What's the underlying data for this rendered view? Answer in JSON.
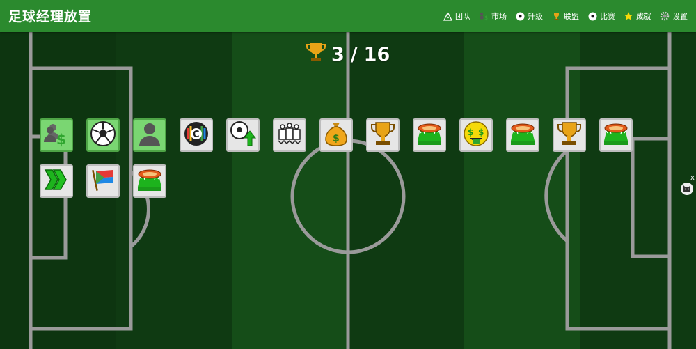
{
  "app": {
    "title": "足球经理放置"
  },
  "nav": [
    {
      "label": "团队",
      "icon": "triangle-team-icon"
    },
    {
      "label": "市场",
      "icon": "market-icon"
    },
    {
      "label": "升级",
      "icon": "soccer-ball-icon"
    },
    {
      "label": "联盟",
      "icon": "trophy-icon"
    },
    {
      "label": "比赛",
      "icon": "soccer-ball-icon"
    },
    {
      "label": "成就",
      "icon": "star-icon"
    },
    {
      "label": "设置",
      "icon": "gear-icon"
    }
  ],
  "counter": {
    "current": "3",
    "separator": "/",
    "total": "16",
    "icon": "trophy-icon"
  },
  "achievements": [
    {
      "icon": "players-money-icon",
      "unlocked": true
    },
    {
      "icon": "soccer-ball-icon",
      "unlocked": true
    },
    {
      "icon": "player-silhouette-icon",
      "unlocked": true
    },
    {
      "icon": "captain-badge-icon",
      "unlocked": false
    },
    {
      "icon": "ball-upgrade-icon",
      "unlocked": false
    },
    {
      "icon": "fans-crowd-icon",
      "unlocked": false
    },
    {
      "icon": "money-bag-icon",
      "unlocked": false
    },
    {
      "icon": "trophy-icon",
      "unlocked": false
    },
    {
      "icon": "stadium-icon",
      "unlocked": false
    },
    {
      "icon": "money-face-icon",
      "unlocked": false
    },
    {
      "icon": "stadium-icon",
      "unlocked": false
    },
    {
      "icon": "trophy-icon",
      "unlocked": false
    },
    {
      "icon": "stadium-icon",
      "unlocked": false
    },
    {
      "icon": "fast-forward-icon",
      "unlocked": false
    },
    {
      "icon": "flag-icon",
      "unlocked": false
    },
    {
      "icon": "stadium-icon",
      "unlocked": false
    }
  ],
  "side": {
    "close": "x",
    "icon": "cat-avatar-icon"
  },
  "colors": {
    "header": "#2b8a2e",
    "field_dark": "#0d3510",
    "field_light": "#154d18",
    "active_tile": "#7ad672"
  }
}
